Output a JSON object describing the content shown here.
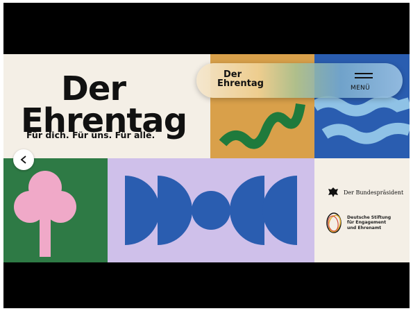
{
  "hero": {
    "title_line1": "Der",
    "title_line2": "Ehrentag",
    "subtitle": "Für dich. Für uns. Für alle."
  },
  "nav": {
    "logo_line1": "Der",
    "logo_line2": "Ehrentag",
    "menu_label": "MENÜ",
    "menu_icon": "hamburger-icon"
  },
  "controls": {
    "back_icon": "chevron-left-icon"
  },
  "partners": {
    "bundespraesident": "Der Bundespräsident",
    "stiftung_line1": "Deutsche Stiftung",
    "stiftung_line2": "für Engagement",
    "stiftung_line3": "und Ehrenamt"
  },
  "colors": {
    "cream": "#f4efe6",
    "mustard": "#d9a04a",
    "blue": "#2a5db0",
    "light_blue": "#8fc2e6",
    "green": "#2e7a45",
    "pink": "#f0a9c8",
    "lavender": "#cfc0ea",
    "dark_green": "#1f7a3c"
  }
}
